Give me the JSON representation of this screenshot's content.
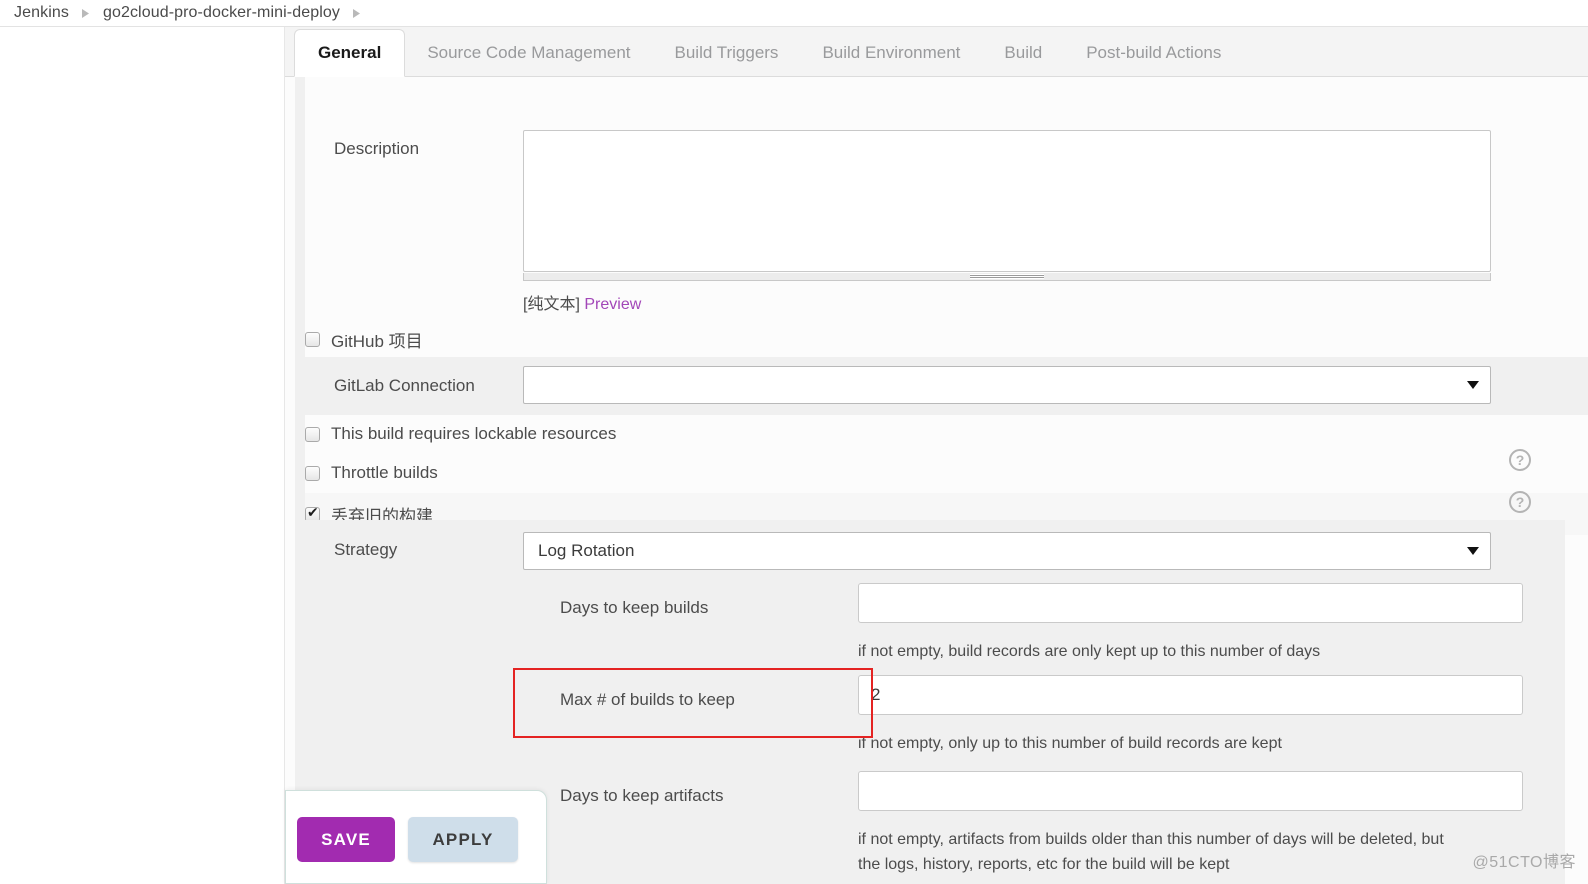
{
  "breadcrumb": {
    "items": [
      "Jenkins",
      "go2cloud-pro-docker-mini-deploy"
    ],
    "separator_icon": "chevron-right-icon"
  },
  "tabs": [
    {
      "label": "General",
      "active": true
    },
    {
      "label": "Source Code Management",
      "active": false
    },
    {
      "label": "Build Triggers",
      "active": false
    },
    {
      "label": "Build Environment",
      "active": false
    },
    {
      "label": "Build",
      "active": false
    },
    {
      "label": "Post-build Actions",
      "active": false
    }
  ],
  "description": {
    "label": "Description",
    "value": "",
    "markup_note": "[纯文本]",
    "preview_link": "Preview"
  },
  "options": {
    "github_project": {
      "label": "GitHub 项目",
      "checked": false
    },
    "gitlab_connection": {
      "label": "GitLab Connection",
      "value": "",
      "caret_icon": "caret-down-icon"
    },
    "lockable_resources": {
      "label": "This build requires lockable resources",
      "checked": false
    },
    "throttle_builds": {
      "label": "Throttle builds",
      "checked": false,
      "help_icon": "help-icon"
    },
    "discard_old_builds": {
      "label": "丢弃旧的构建",
      "checked": true,
      "help_icon": "help-icon"
    }
  },
  "strategy": {
    "label": "Strategy",
    "value": "Log Rotation",
    "caret_icon": "caret-down-icon",
    "fields": [
      {
        "label": "Days to keep builds",
        "value": "",
        "hint": "if not empty, build records are only kept up to this number of days",
        "highlighted": false
      },
      {
        "label": "Max # of builds to keep",
        "value": "2",
        "hint": "if not empty, only up to this number of build records are kept",
        "highlighted": true
      },
      {
        "label": "Days to keep artifacts",
        "value": "",
        "hint": "if not empty, artifacts from builds older than this number of days will be deleted, but the logs, history, reports, etc for the build will be kept",
        "hint_line1": "if not empty, artifacts from builds older than this number of days will be deleted, but",
        "hint_line2": "the logs, history, reports, etc for the build will be kept",
        "highlighted": false
      }
    ]
  },
  "footer": {
    "save_label": "SAVE",
    "apply_label": "APPLY",
    "save_color": "#a22bb0",
    "apply_color": "#cfdeea"
  },
  "watermark": "@51CTO博客",
  "colors": {
    "accent_purple": "#a22bb0",
    "link_purple": "#a246b8",
    "highlight_red": "#e42322",
    "panel_gray": "#f0f0f0"
  }
}
